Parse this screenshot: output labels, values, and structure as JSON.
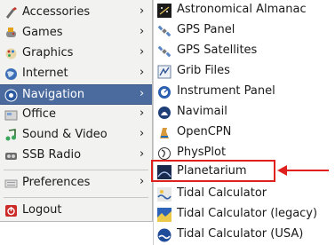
{
  "main_menu": {
    "items": [
      {
        "label": "Accessories",
        "icon": "accessories-icon"
      },
      {
        "label": "Games",
        "icon": "games-icon"
      },
      {
        "label": "Graphics",
        "icon": "graphics-icon"
      },
      {
        "label": "Internet",
        "icon": "internet-icon"
      },
      {
        "label": "Navigation",
        "icon": "navigation-icon"
      },
      {
        "label": "Office",
        "icon": "office-icon"
      },
      {
        "label": "Sound & Video",
        "icon": "sound-video-icon"
      },
      {
        "label": "SSB Radio",
        "icon": "ssb-radio-icon"
      },
      {
        "label": "Preferences",
        "icon": "preferences-icon"
      },
      {
        "label": "Logout",
        "icon": "logout-icon"
      }
    ],
    "arrow": "›",
    "highlighted": "Navigation",
    "highlight_color": "#4b6b9f"
  },
  "submenu": {
    "items": [
      {
        "label": "Astronomical Almanac",
        "icon": "almanac-icon"
      },
      {
        "label": "GPS Panel",
        "icon": "satellite-icon"
      },
      {
        "label": "GPS Satellites",
        "icon": "satellite-icon"
      },
      {
        "label": "Grib Files",
        "icon": "grib-icon"
      },
      {
        "label": "Instrument Panel",
        "icon": "instrument-icon"
      },
      {
        "label": "Navimail",
        "icon": "navimail-icon"
      },
      {
        "label": "OpenCPN",
        "icon": "opencpn-icon"
      },
      {
        "label": "PhysPlot",
        "icon": "physplot-icon"
      },
      {
        "label": "Planetarium",
        "icon": "planetarium-icon"
      },
      {
        "label": "Tidal Calculator",
        "icon": "tidal-icon"
      },
      {
        "label": "Tidal Calculator (legacy)",
        "icon": "tidal-legacy-icon"
      },
      {
        "label": "Tidal Calculator (USA)",
        "icon": "tidal-usa-icon"
      }
    ],
    "emphasized": "Planetarium",
    "annotation_color": "#e0201d"
  }
}
